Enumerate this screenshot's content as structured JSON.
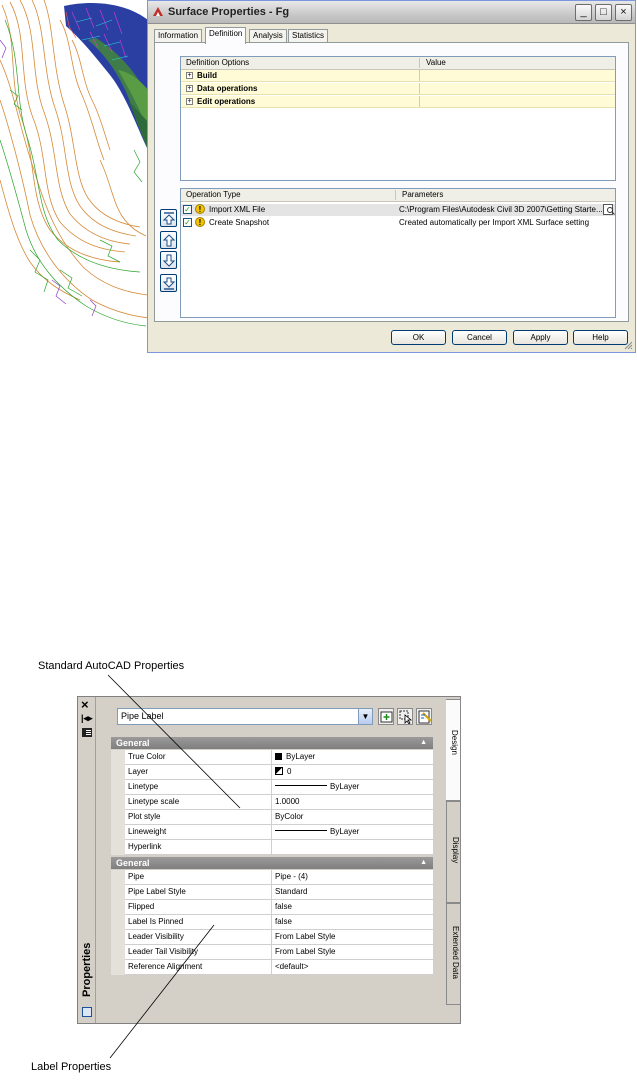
{
  "surface_dialog": {
    "title": "Surface Properties - Fg",
    "window_buttons": {
      "minimize": "_",
      "maximize": "□",
      "close": "×"
    },
    "tabs": [
      {
        "label": "Information"
      },
      {
        "label": "Definition"
      },
      {
        "label": "Analysis"
      },
      {
        "label": "Statistics"
      }
    ],
    "definition_table": {
      "columns": [
        "Definition Options",
        "Value"
      ],
      "rows": [
        {
          "label": "Build"
        },
        {
          "label": "Data operations"
        },
        {
          "label": "Edit operations"
        }
      ]
    },
    "operations_table": {
      "columns": [
        "Operation Type",
        "Parameters"
      ],
      "rows": [
        {
          "type": "Import XML File",
          "parameters": "C:\\Program Files\\Autodesk Civil 3D 2007\\Getting Starte..."
        },
        {
          "type": "Create Snapshot",
          "parameters": "Created automatically per Import XML Surface setting"
        }
      ]
    },
    "buttons": {
      "ok": "OK",
      "cancel": "Cancel",
      "apply": "Apply",
      "help": "Help"
    }
  },
  "callouts": {
    "standard": "Standard AutoCAD Properties",
    "label": "Label Properties"
  },
  "properties_palette": {
    "palette_name": "Properties",
    "object_selector": "Pipe Label",
    "side_tabs": [
      "Design",
      "Display",
      "Extended Data"
    ],
    "categories": [
      {
        "title": "General",
        "rows": [
          {
            "name": "True Color",
            "value": "ByLayer"
          },
          {
            "name": "Layer",
            "value": "0"
          },
          {
            "name": "Linetype",
            "value": "ByLayer"
          },
          {
            "name": "Linetype scale",
            "value": "1.0000"
          },
          {
            "name": "Plot style",
            "value": "ByColor"
          },
          {
            "name": "Lineweight",
            "value": "ByLayer"
          },
          {
            "name": "Hyperlink",
            "value": ""
          }
        ]
      },
      {
        "title": "General",
        "rows": [
          {
            "name": "Pipe",
            "value": "Pipe - (4)"
          },
          {
            "name": "Pipe Label Style",
            "value": "Standard"
          },
          {
            "name": "Flipped",
            "value": "false"
          },
          {
            "name": "Label Is Pinned",
            "value": "false"
          },
          {
            "name": "Leader Visibility",
            "value": "From Label Style"
          },
          {
            "name": "Leader Tail Visibility",
            "value": "From Label Style"
          },
          {
            "name": "Reference Alignment",
            "value": "<default>"
          }
        ]
      }
    ]
  },
  "colors": {
    "dialog_face": "#ece9d8",
    "row_highlight": "#fffbd6",
    "category_header": "#808080",
    "surface_blue": "#2a3d9e",
    "surface_green": "#3b7f3b"
  }
}
